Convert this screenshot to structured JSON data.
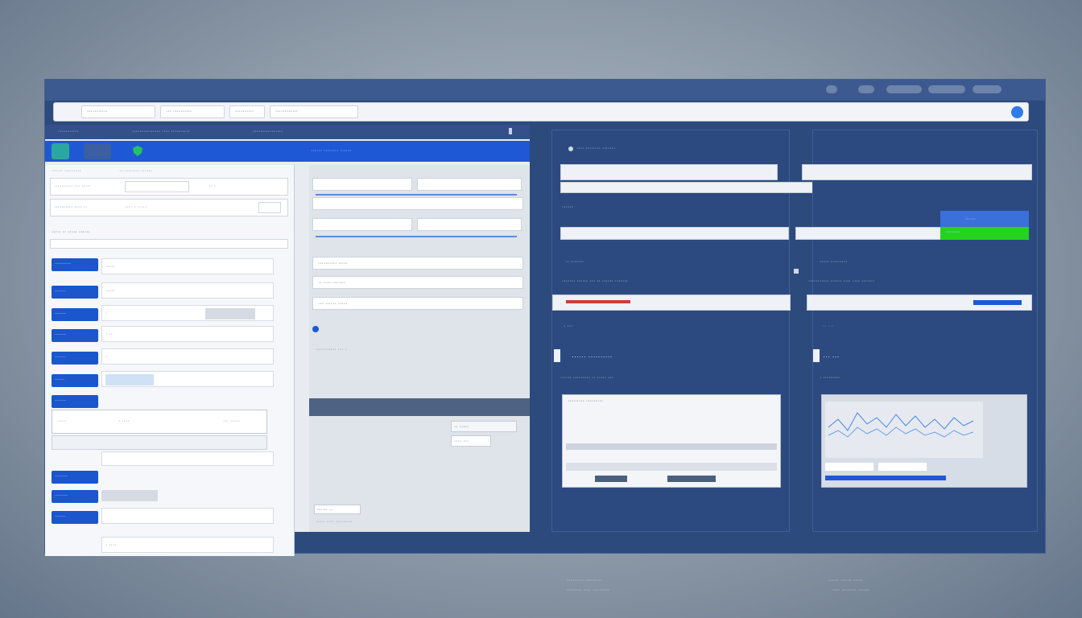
{
  "address": {
    "tabs": [
      "···········",
      "··· ··········",
      "··········",
      "············"
    ]
  },
  "left": {
    "tabs": [
      "···········",
      "··············· ···· ··········",
      "················"
    ],
    "banner_title": "······ ········ ······",
    "form": {
      "header_left": "······ ·········",
      "header_right": "·· ········ ······",
      "row1": [
        "·········· ··· ·····",
        "·· ·"
      ],
      "row2": [
        "·········· ···· ··",
        "···· · ·····"
      ],
      "section_label": "····· ·· ····· ······",
      "side_buttons": [
        "··········",
        "·······",
        "·······",
        "·······",
        "·······",
        "······",
        "·······",
        "·····",
        "········",
        "········",
        "·······"
      ],
      "field_values": [
        "·····",
        "·····",
        "·",
        "· ··",
        "·",
        "",
        "· ····",
        "··· ·····",
        "",
        "",
        "",
        "· ····"
      ]
    },
    "middle": {
      "rows": [
        "·········· ·····",
        "·· ···· ·······",
        "··· ······ ·····",
        "··· ········ ···",
        "······ ··"
      ],
      "note": "··········· ··· ·",
      "small_btn_left": "·· ·····",
      "small_btn_right": "···· ···",
      "footer": "····· ···· ·········"
    }
  },
  "right_left": {
    "header": "···· ········ ·······",
    "tag": "······",
    "section1": "·· ·······",
    "section1_meta": "······· ······ ··· ·· ······ ·······",
    "counter": "· ···",
    "title": "······ ··········",
    "subtitle": "······ ········· ·· ····· ···",
    "table_header": "········· ·········",
    "footer1": "········· ·········",
    "footer2": "········ ···· ·········"
  },
  "right_right": {
    "green_btn": "········",
    "blue_btn": "······",
    "section1": "····· ·········",
    "section1_meta": "··········· ······ ···· ···· ·······",
    "counter": "·· ···",
    "title": "··· ···",
    "subtitle": "· ·········",
    "footer1": "······ ······ ·····",
    "footer2": "···· ········ ······"
  },
  "colors": {
    "accent": "#1f58d4",
    "success": "#23d31e",
    "panel": "#2c4a80"
  }
}
